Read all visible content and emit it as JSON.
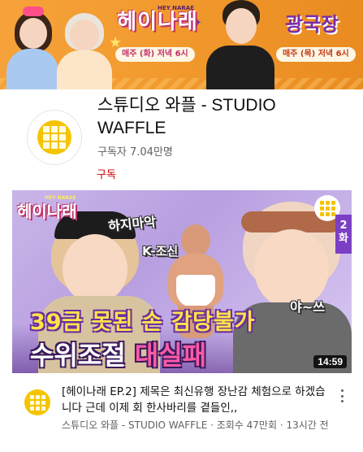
{
  "banner": {
    "left_show_logo": "헤이나래",
    "left_show_logo_sub": "HEY NARAE",
    "left_schedule": "매주 (화) 저녁 6시",
    "right_show_logo": "광국장",
    "right_schedule": "매주 (목) 저녁 6시"
  },
  "channel": {
    "name": "스튜디오 와플 - STUDIO WAFFLE",
    "subscribers": "구독자 7.04만명",
    "subscribe_label": "구독"
  },
  "video": {
    "thumbnail": {
      "show_logo": "헤이나래",
      "show_logo_sub": "HEY NARAE",
      "caption_top": "하지마악",
      "caption_mid": "K-조신",
      "caption_right": "야~쓰",
      "headline_1": "39금 못된 손 감당불가",
      "headline_2a": "수위조절 ",
      "headline_2b": "대실패",
      "episode_badge": "2화",
      "duration": "14:59"
    },
    "title": "[헤이나래 EP.2] 제목은 최신유행 장난감 체험으로 하겠습니다 근데 이제 회 한사바리를 곁들인,,",
    "meta": "스튜디오 와플 - STUDIO WAFFLE · 조회수 47만회 · 13시간 전"
  },
  "icons": {
    "channel_avatar": "waffle-logo-icon",
    "video_avatar": "waffle-logo-icon",
    "more": "more-vert-icon"
  }
}
